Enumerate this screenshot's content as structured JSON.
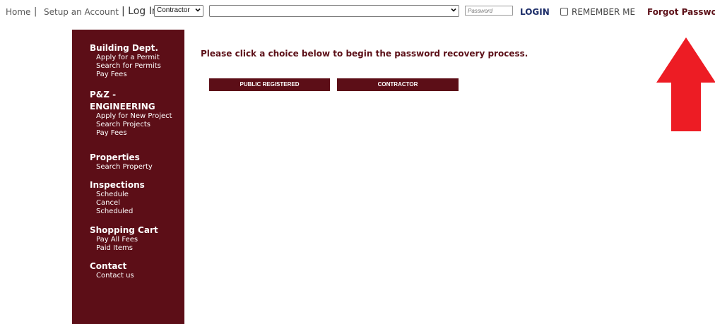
{
  "topbar": {
    "home": "Home",
    "separator": "|",
    "setup_account": "Setup an Account",
    "login_label": "| Log In",
    "account_type_selected": "Contractor",
    "user_selected": "",
    "password_placeholder": "Password",
    "login_button": "LOGIN",
    "remember_me": "REMEMBER ME",
    "remember_checked": false,
    "forgot_password": "Forgot Password"
  },
  "sidebar": {
    "background": "#5c0e17",
    "sections": [
      {
        "heading": "Building Dept.",
        "items": [
          "Apply for a Permit",
          "Search for Permits",
          "Pay Fees"
        ]
      },
      {
        "heading": "P&Z -",
        "heading2": "ENGINEERING",
        "items": [
          "Apply for New Project",
          "Search Projects",
          "Pay Fees"
        ]
      },
      {
        "heading": "Properties",
        "items": [
          "Search Property"
        ]
      },
      {
        "heading": "Inspections",
        "items": [
          "Schedule",
          "Cancel",
          "Scheduled"
        ]
      },
      {
        "heading": "Shopping Cart",
        "items": [
          "Pay All Fees",
          "Paid Items"
        ]
      },
      {
        "heading": "Contact",
        "items": [
          "Contact us"
        ]
      }
    ]
  },
  "main": {
    "instructions": "Please click a choice below to begin the password recovery process.",
    "choices": [
      "PUBLIC REGISTERED",
      "CONTRACTOR"
    ]
  },
  "annotation": {
    "arrow_color": "#ed1c24",
    "arrow_icon": "up-arrow-icon"
  }
}
